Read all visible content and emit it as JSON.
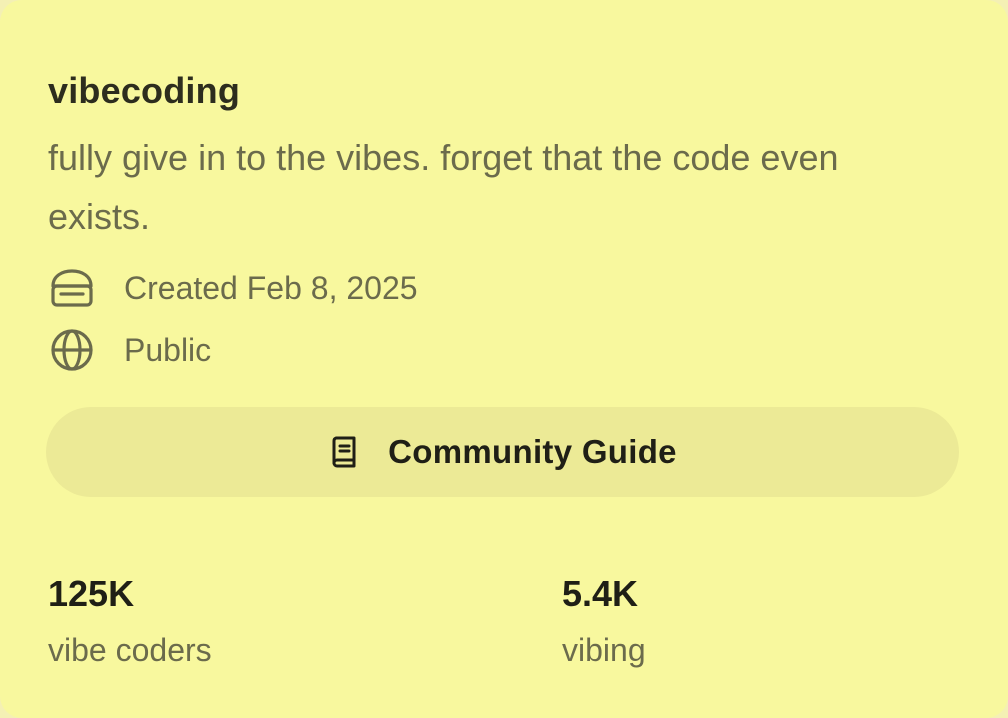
{
  "community": {
    "name": "vibecoding",
    "description": "fully give in to the vibes. forget that the code even exists.",
    "created": "Created Feb 8, 2025",
    "visibility": "Public",
    "icons": {
      "created": "cake-icon",
      "visibility": "globe-icon",
      "guide": "book-icon"
    }
  },
  "guide_button": {
    "label": "Community Guide"
  },
  "stats": {
    "members": {
      "value": "125K",
      "label": "vibe coders"
    },
    "online": {
      "value": "5.4K",
      "label": "vibing"
    }
  },
  "colors": {
    "card_background": "#f8f89e",
    "button_background": "#ecea96",
    "primary_text": "#1f1f16",
    "secondary_text": "#6b6b4c"
  }
}
